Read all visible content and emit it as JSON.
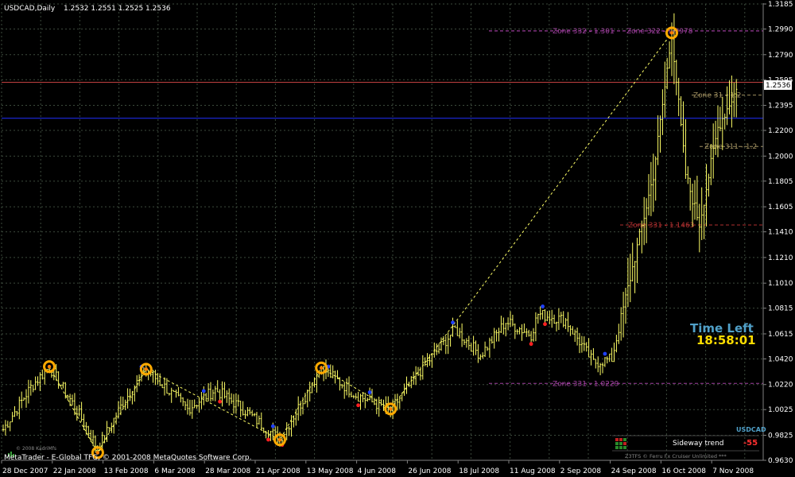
{
  "header": {
    "symbol_tf": "USDCAD,Daily",
    "ohlc": "1.2532 1.2551 1.2525 1.2536"
  },
  "colors": {
    "background": "#000000",
    "grid": "#3c4a3c",
    "candle": "#ffff66",
    "fractal_high": "#2040ff",
    "fractal_low": "#ff2020",
    "pivot": "#ffaa00",
    "zone_magenta": "#a040a0",
    "zone_red": "#b03030",
    "line_red": "#c04040",
    "line_blue": "#2030ff",
    "time_left": "#50a0c8",
    "time_value": "#ffdd00"
  },
  "footer": {
    "copyright": "MetaTrader - E-Global TFG, © 2001-2008 MetaQuotes Software Corp.",
    "small_credit": "© 2008 KadriMfs"
  },
  "panel": {
    "time_left_label": "Time Left",
    "time_left_value": "18:58:01",
    "symbol": "USDCAD",
    "trend_label": "Sideway trend",
    "trend_score": "-55",
    "credit": "Z3TFS © Ferru Fx Cruiser Unlimited ***"
  },
  "price_box": "1.2536",
  "zones": [
    {
      "label": "Zone 332 - 1.301",
      "price": 1.2975,
      "color": "#a040a0"
    },
    {
      "label": "Zone 322 - 1.2978",
      "price": 1.2975,
      "color": "#a040a0"
    },
    {
      "label": "Zone 31 - 1.2",
      "price": 1.2475,
      "color": "#a09060"
    },
    {
      "label": "Zone 311 - 1.2",
      "price": 1.2075,
      "color": "#a09060"
    },
    {
      "label": "Zone 331 - 1.1463",
      "price": 1.1463,
      "color": "#b03030"
    },
    {
      "label": "Zone 331 - 1.0229",
      "price": 1.0229,
      "color": "#a040a0"
    }
  ],
  "chart_data": {
    "type": "bar",
    "title": "USDCAD,Daily",
    "ylim": [
      0.963,
      1.3185
    ],
    "y_ticks": [
      0.963,
      0.9825,
      1.0025,
      1.022,
      1.042,
      1.0615,
      1.0815,
      1.101,
      1.121,
      1.141,
      1.1605,
      1.1805,
      1.2,
      1.22,
      1.2395,
      1.2595,
      1.279,
      1.299,
      1.3185
    ],
    "x_labels": [
      "28 Dec 2007",
      "22 Jan 2008",
      "13 Feb 2008",
      "6 Mar 2008",
      "28 Mar 2008",
      "21 Apr 2008",
      "13 May 2008",
      "4 Jun 2008",
      "26 Jun 2008",
      "18 Jul 2008",
      "11 Aug 2008",
      "2 Sep 2008",
      "24 Sep 2008",
      "16 Oct 2008",
      "7 Nov 2008"
    ],
    "n_bars": 230,
    "anchors": [
      [
        0,
        0.987
      ],
      [
        12,
        1.02
      ],
      [
        20,
        1.036
      ],
      [
        32,
        1.002
      ],
      [
        41,
        0.972
      ],
      [
        52,
        1.008
      ],
      [
        62,
        1.034
      ],
      [
        80,
        1.003
      ],
      [
        92,
        1.018
      ],
      [
        104,
        1.003
      ],
      [
        120,
        0.979
      ],
      [
        138,
        1.035
      ],
      [
        153,
        1.014
      ],
      [
        168,
        1.002
      ],
      [
        182,
        1.035
      ],
      [
        196,
        1.065
      ],
      [
        207,
        1.045
      ],
      [
        218,
        1.071
      ],
      [
        229,
        1.061
      ],
      [
        232,
        1.077
      ],
      [
        244,
        1.072
      ],
      [
        256,
        1.039
      ],
      [
        264,
        1.042
      ],
      [
        272,
        1.105
      ],
      [
        282,
        1.185
      ],
      [
        290,
        1.295
      ],
      [
        296,
        1.186
      ],
      [
        302,
        1.147
      ],
      [
        310,
        1.222
      ],
      [
        318,
        1.252
      ]
    ],
    "horizontal_lines": [
      1.2575,
      1.2295
    ],
    "pivots": [
      [
        20,
        1.036
      ],
      [
        41,
        0.969
      ],
      [
        62,
        1.034
      ],
      [
        120,
        0.979
      ],
      [
        138,
        1.035
      ],
      [
        168,
        1.003
      ],
      [
        290,
        1.296
      ]
    ],
    "zigzag": [
      [
        20,
        1.036
      ],
      [
        41,
        0.969
      ],
      [
        62,
        1.034
      ],
      [
        120,
        0.979
      ],
      [
        138,
        1.035
      ],
      [
        168,
        1.003
      ],
      [
        290,
        1.296
      ]
    ],
    "series": []
  }
}
